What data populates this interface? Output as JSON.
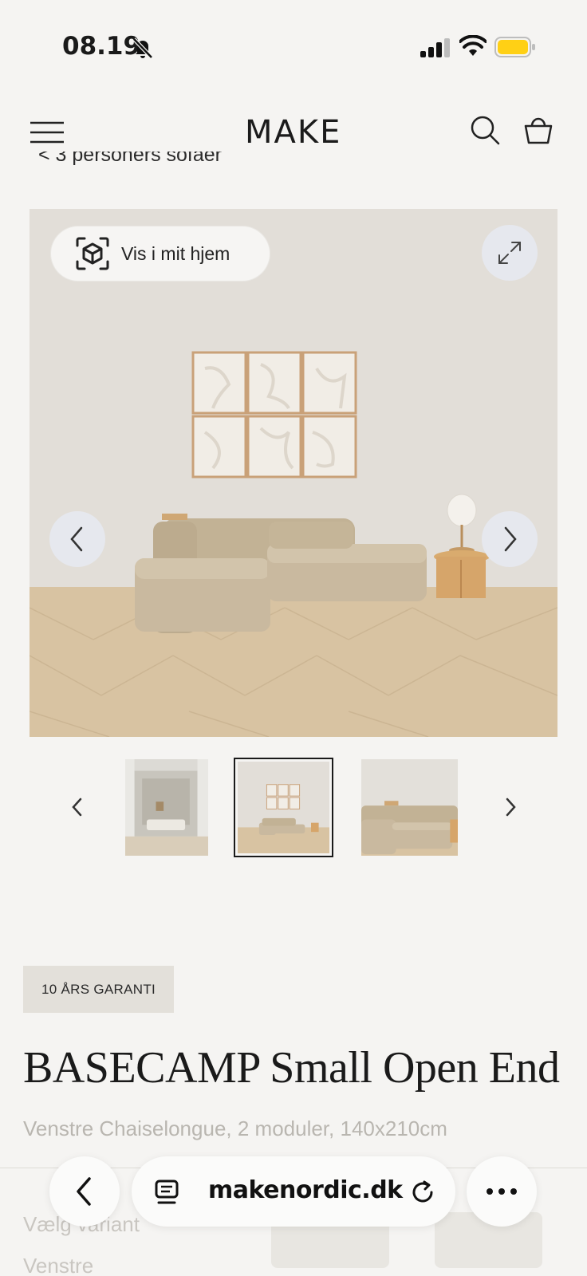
{
  "status_bar": {
    "time": "08.19",
    "icons": [
      "bell-slash-icon",
      "signal-icon",
      "wifi-icon",
      "battery-icon"
    ],
    "battery_color": "#ffd015"
  },
  "header": {
    "logo": "MAKE",
    "icons": [
      "menu-icon",
      "search-icon",
      "basket-icon"
    ]
  },
  "breadcrumb": {
    "text": "< 3 personers sofaer"
  },
  "gallery": {
    "ar_button_label": "Vis i mit hjem",
    "icons": [
      "ar-cube-icon",
      "expand-icon",
      "chevron-left-icon",
      "chevron-right-icon"
    ],
    "thumbnails": [
      "thumbnail-1",
      "thumbnail-2",
      "thumbnail-3"
    ],
    "selected_thumbnail": 2
  },
  "product": {
    "badge": "10 ÅRS GARANTI",
    "title": "BASECAMP Small Open End",
    "subtitle": "Venstre Chaiselongue, 2 moduler, 140x210cm",
    "variant_label": "Vælg variant",
    "variant_value": "Venstre"
  },
  "browser": {
    "url": "makenordic.dk",
    "icons": [
      "back-icon",
      "tabs-icon",
      "reload-icon",
      "more-icon"
    ]
  },
  "colors": {
    "background": "#f5f4f2",
    "badge_bg": "#e3e0da",
    "wall": "#e2ded8",
    "floor": "#d8c3a2",
    "sofa": "#c8b89e"
  }
}
